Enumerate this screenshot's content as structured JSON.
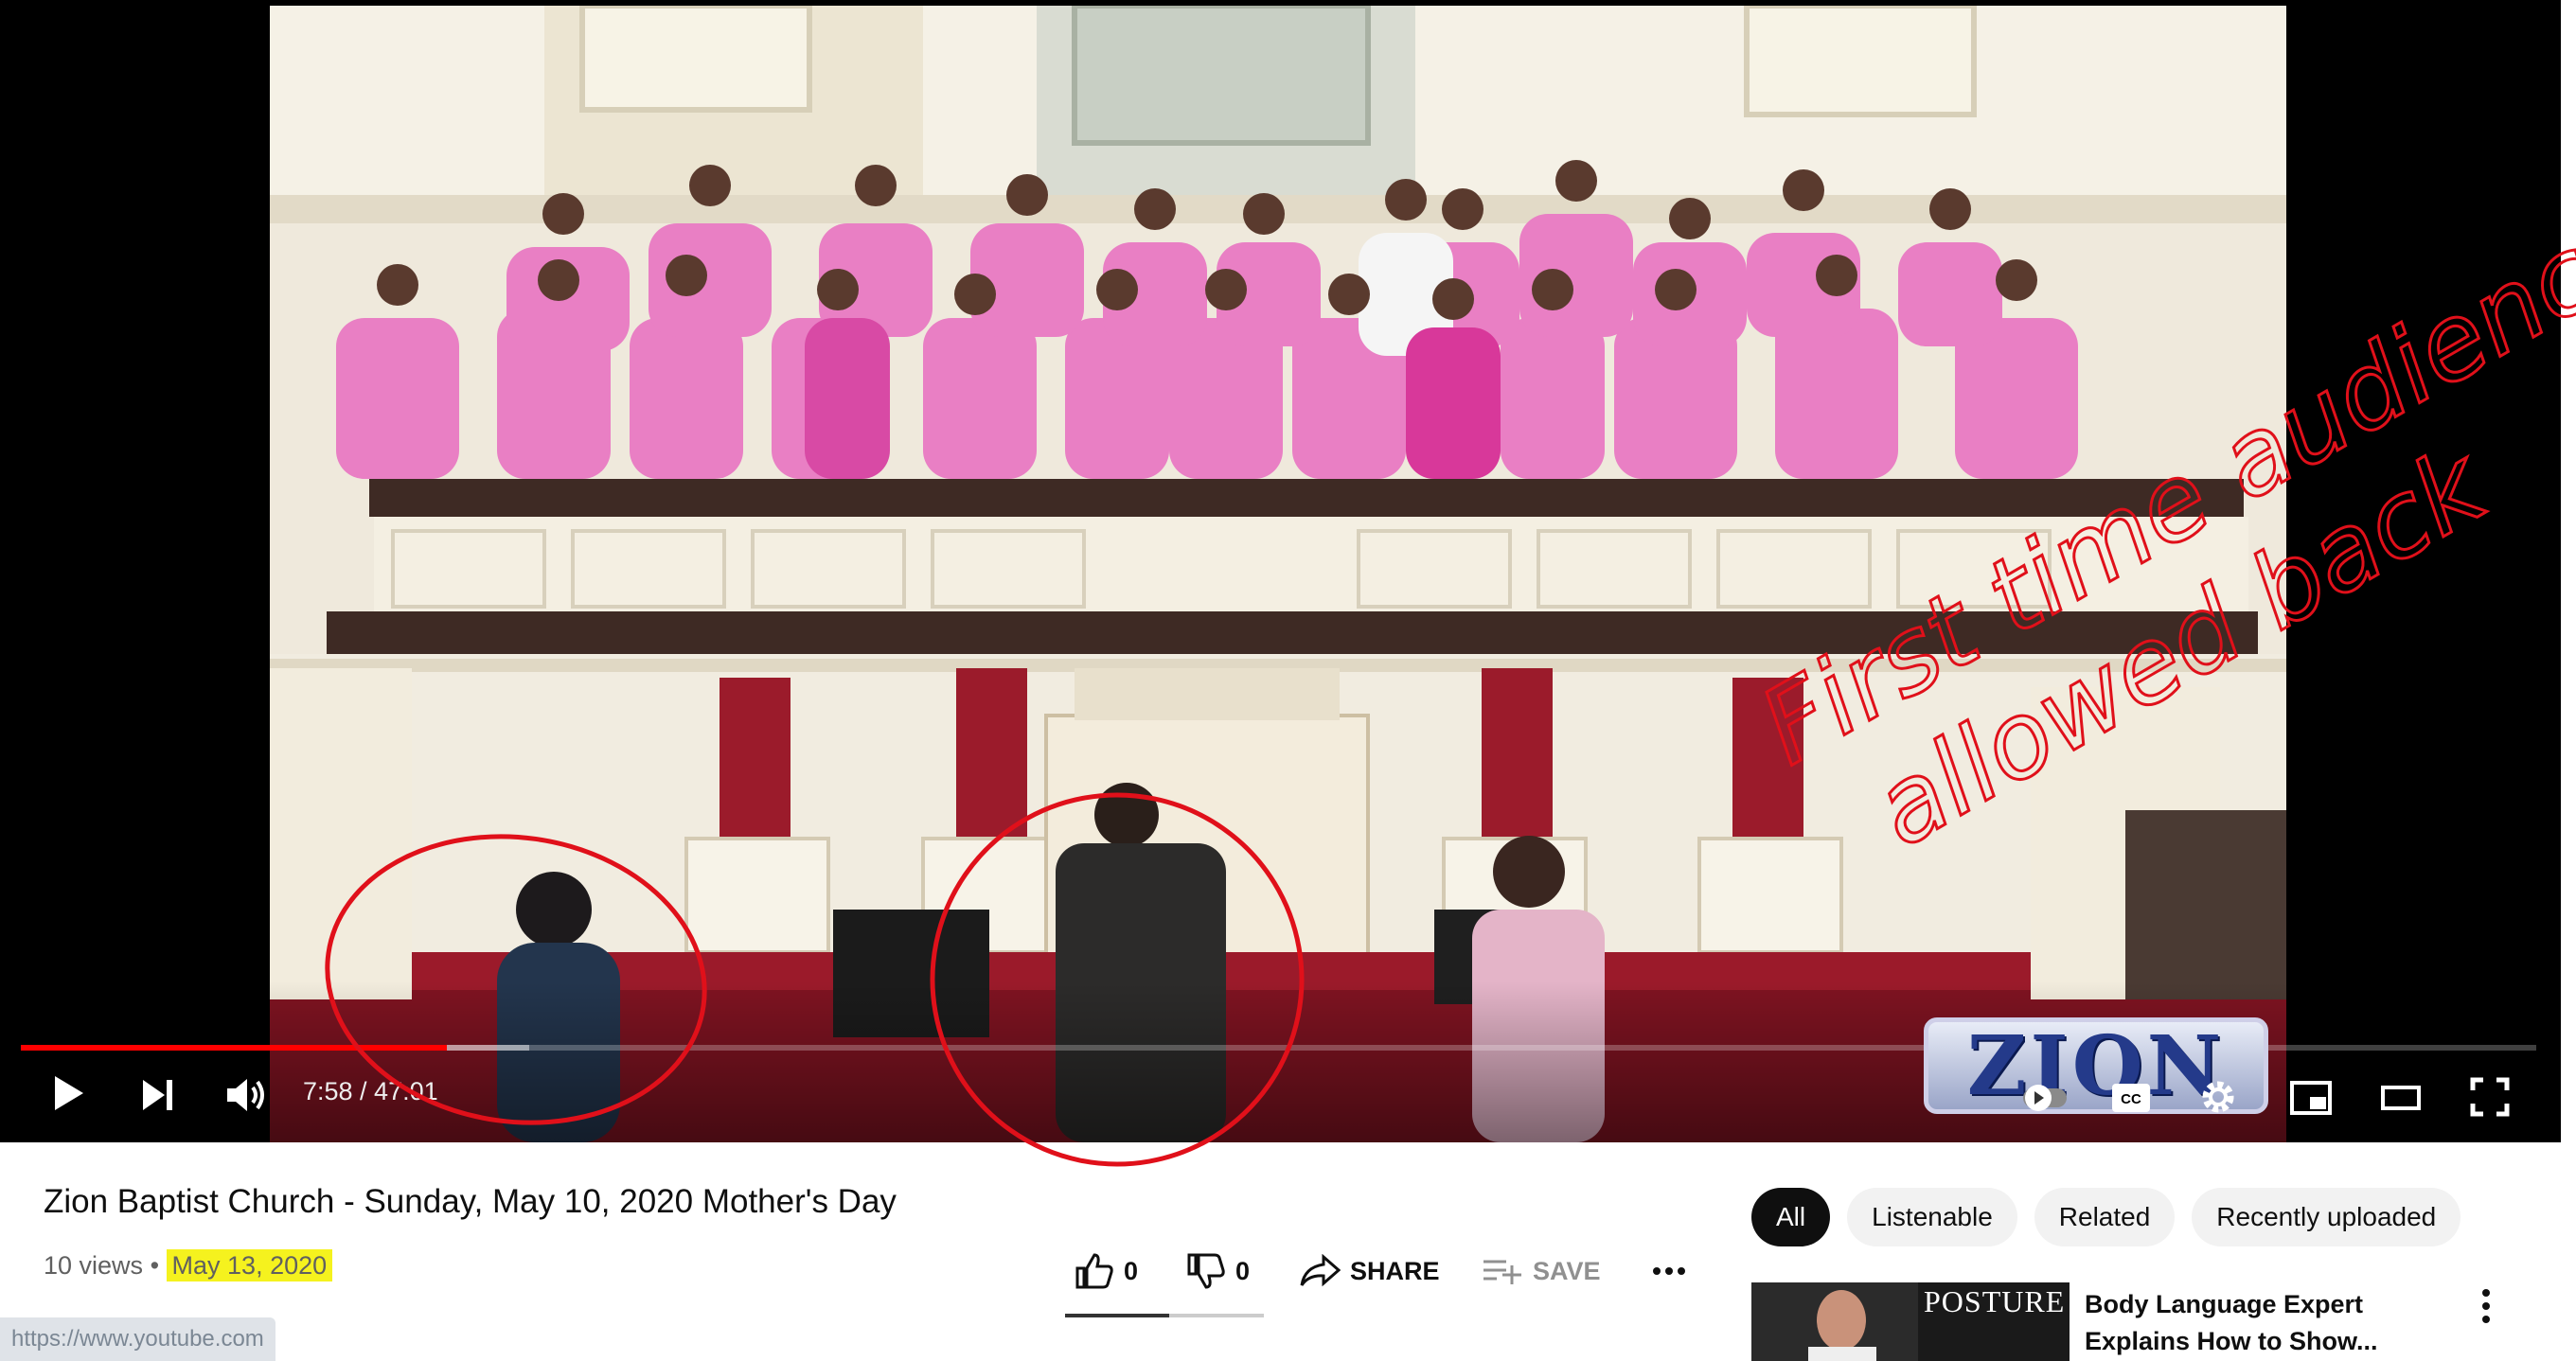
{
  "player": {
    "time_current": "7:58",
    "time_total": "47:01",
    "time_display": "7:58 / 47:01",
    "progress_fraction": 0.1695,
    "buffered_fraction": 0.202,
    "watermark_text": "ZION",
    "accent_color": "#ff0000"
  },
  "video_info": {
    "title": "Zion Baptist Church - Sunday, May 10, 2020 Mother's Day",
    "views": "10 views",
    "separator": "•",
    "date": "May 13, 2020"
  },
  "actions": {
    "like_count": "0",
    "dislike_count": "0",
    "share_label": "SHARE",
    "save_label": "SAVE"
  },
  "filters": {
    "chips": [
      "All",
      "Listenable",
      "Related",
      "Recently uploaded"
    ],
    "active": "All"
  },
  "recommendation": {
    "thumbnail_text": "POSTURE",
    "title": "Body Language Expert Explains How to Show..."
  },
  "status_bar": {
    "url": "https://www.youtube.com"
  },
  "annotation": {
    "line1": "First time audience",
    "line2": "allowed back",
    "color": "#e0101a"
  }
}
